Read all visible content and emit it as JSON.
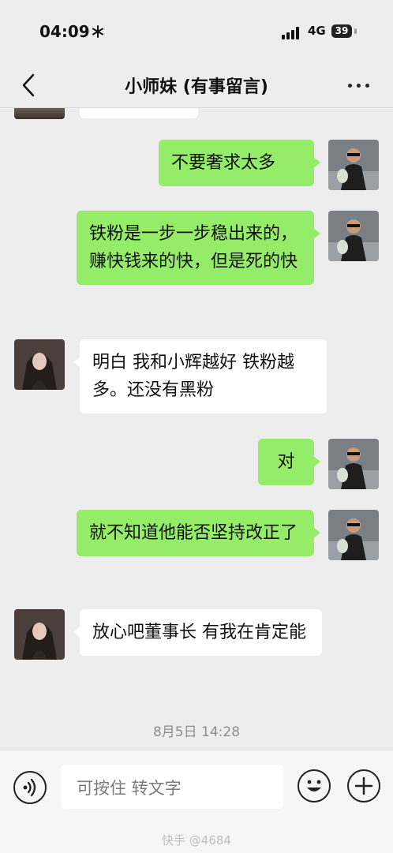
{
  "status_bar": {
    "time": "04:09",
    "network": "4G",
    "battery": "39"
  },
  "nav": {
    "title": "小师妹 (有事留言)"
  },
  "messages": [
    {
      "sender": "me",
      "text": "不要奢求太多"
    },
    {
      "sender": "me",
      "text": "铁粉是一步一步稳出来的，赚快钱来的快，但是死的快"
    },
    {
      "sender": "other",
      "text": "明白 我和小辉越好 铁粉越多。还没有黑粉"
    },
    {
      "sender": "me",
      "text": "对"
    },
    {
      "sender": "me",
      "text": "就不知道他能否坚持改正了"
    },
    {
      "sender": "other",
      "text": "放心吧董事长 有我在肯定能"
    }
  ],
  "timestamp": "8月5日 14:28",
  "input": {
    "placeholder": "可按住 转文字"
  },
  "watermark": "快手 @4684"
}
